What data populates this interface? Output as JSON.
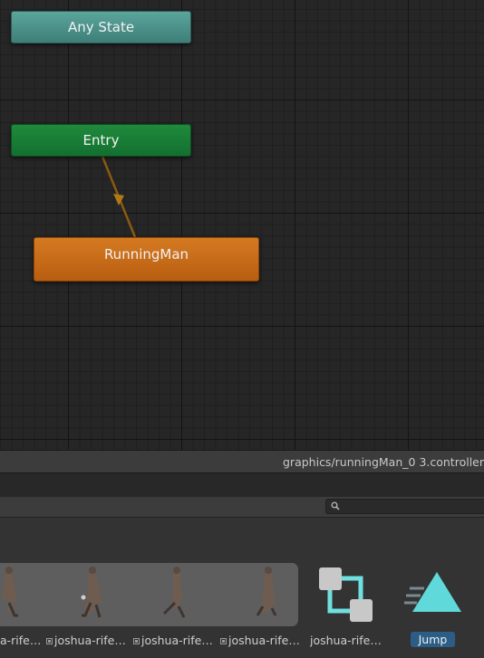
{
  "graph": {
    "states": {
      "any_state": "Any State",
      "entry": "Entry",
      "default_state": "RunningMan"
    }
  },
  "status": {
    "path": "graphics/runningMan_0 3.controller"
  },
  "search": {
    "placeholder": ""
  },
  "assets": {
    "items": [
      {
        "label": "a-rife…"
      },
      {
        "label": "joshua-rife…"
      },
      {
        "label": "joshua-rife…"
      },
      {
        "label": "joshua-rife…"
      },
      {
        "label": "joshua-rife…"
      },
      {
        "label": "Jump"
      }
    ]
  },
  "colors": {
    "any_state": "#4f9990",
    "entry": "#1a7f36",
    "default_state": "#c86c18",
    "selection": "#2c5d87",
    "jump_icon": "#5fd9d9"
  }
}
